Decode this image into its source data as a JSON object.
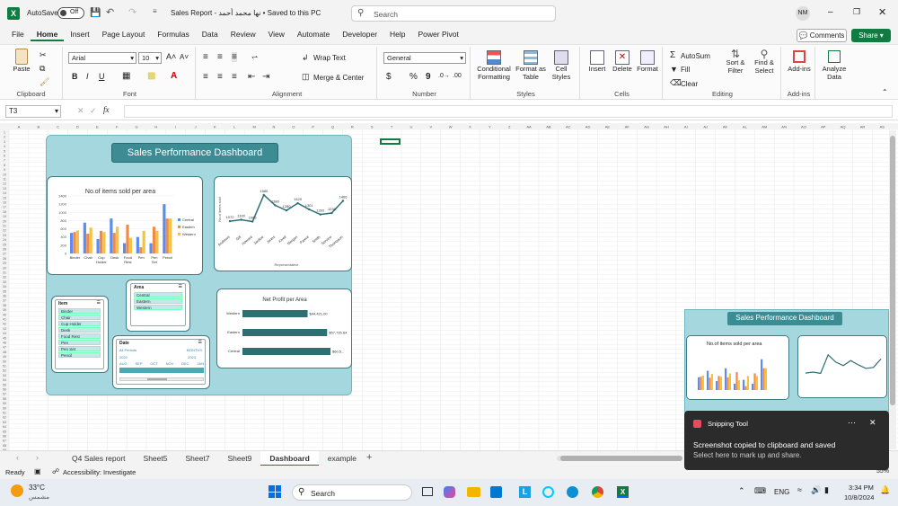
{
  "title_bar": {
    "autosave_label": "AutoSave",
    "autosave_state": "Off",
    "file_title": "Sales Report - نها محمد أحمد • Saved to this PC",
    "search_placeholder": "Search",
    "user_initials": "NM"
  },
  "menu": {
    "items": [
      "File",
      "Home",
      "Insert",
      "Page Layout",
      "Formulas",
      "Data",
      "Review",
      "View",
      "Automate",
      "Developer",
      "Help",
      "Power Pivot"
    ],
    "comments_label": "Comments",
    "share_label": "Share"
  },
  "ribbon": {
    "clipboard": {
      "paste": "Paste",
      "label": "Clipboard"
    },
    "font": {
      "name": "Arial",
      "size": "10",
      "label": "Font"
    },
    "alignment": {
      "wrap": "Wrap Text",
      "merge": "Merge & Center",
      "label": "Alignment"
    },
    "number": {
      "format": "General",
      "label": "Number"
    },
    "styles": {
      "cond": "Conditional Formatting",
      "table": "Format as Table",
      "cell": "Cell Styles",
      "label": "Styles"
    },
    "cells": {
      "insert": "Insert",
      "delete": "Delete",
      "format": "Format",
      "label": "Cells"
    },
    "editing": {
      "autosum": "AutoSum",
      "fill": "Fill",
      "clear": "Clear",
      "sort": "Sort & Filter",
      "find": "Find & Select",
      "label": "Editing"
    },
    "addins": {
      "addins": "Add-ins",
      "label": "Add-ins"
    },
    "analyze": {
      "label": "Analyze Data"
    }
  },
  "formula_bar": {
    "name_box": "T3",
    "fx": "fx",
    "value": ""
  },
  "grid": {
    "columns": [
      "A",
      "B",
      "C",
      "D",
      "E",
      "F",
      "G",
      "H",
      "I",
      "J",
      "K",
      "L",
      "M",
      "N",
      "O",
      "P",
      "Q",
      "R",
      "S",
      "T",
      "U",
      "V",
      "W",
      "X",
      "Y",
      "Z",
      "AA",
      "AB",
      "AC",
      "AD",
      "AE",
      "AF",
      "AG",
      "AH",
      "AI",
      "AJ",
      "AK",
      "AL",
      "AM",
      "AN",
      "AO",
      "AP",
      "AQ",
      "AR",
      "AS"
    ],
    "rows_count": 70
  },
  "dashboard": {
    "title": "Sales Performance Dashboard",
    "items_chart": {
      "title": "No.of items sold per area",
      "yticks": [
        "1400",
        "1200",
        "1000",
        "800",
        "600",
        "400",
        "200",
        "0"
      ],
      "legend": [
        "Central",
        "Eastern",
        "Western"
      ]
    },
    "rep_chart": {
      "ylabel": "No.of items sold",
      "xlabel": "Representative"
    },
    "profit_chart": {
      "title": "Net Profit per Area"
    },
    "slicer_area": {
      "title": "Area",
      "items": [
        "Central",
        "Eastern",
        "Western"
      ]
    },
    "slicer_item": {
      "title": "Item",
      "items": [
        "Binder",
        "Chair",
        "Cup Holder",
        "Desk",
        "Food Rest",
        "Pen",
        "Pen Set",
        "Pencil"
      ]
    },
    "slicer_date": {
      "title": "Date",
      "left": "All Periods",
      "right": "MONTHS",
      "year_left": "2022",
      "year_right": "2023",
      "months": [
        "AUG",
        "SEP",
        "OCT",
        "NOV",
        "DEC",
        "JAN"
      ]
    }
  },
  "chart_data": [
    {
      "type": "bar",
      "title": "No.of items sold per area",
      "categories": [
        "Binder",
        "Chair",
        "Cup Holder",
        "Desk",
        "Food Rest",
        "Pen",
        "Pen Set",
        "Pencil"
      ],
      "series": [
        {
          "name": "Central",
          "values": [
            500,
            750,
            350,
            850,
            250,
            400,
            250,
            1200
          ]
        },
        {
          "name": "Eastern",
          "values": [
            520,
            480,
            550,
            500,
            700,
            150,
            650,
            850
          ]
        },
        {
          "name": "Western",
          "values": [
            560,
            630,
            520,
            650,
            380,
            550,
            550,
            850
          ]
        }
      ],
      "ylim": [
        0,
        1400
      ],
      "colors": [
        "#5b8def",
        "#f08a4b",
        "#f5c242"
      ]
    },
    {
      "type": "line",
      "categories": [
        "Andrews",
        "Gill",
        "Howard",
        "Jardine",
        "Jones",
        "Kivell",
        "Morgan",
        "Parent",
        "Smith",
        "Sorvino",
        "Thompson"
      ],
      "values": [
        1072,
        1100,
        1065,
        1580,
        1380,
        1280,
        1420,
        1301,
        1202,
        1230,
        1466
      ],
      "labels": [
        "1072",
        "1100",
        "1065",
        "1580",
        "1380",
        "1280",
        "1420",
        "1301",
        "1202",
        "1230",
        "1466"
      ],
      "ylabel": "No.of items sold",
      "xlabel": "Representative",
      "color": "#2e6f73"
    },
    {
      "type": "bar",
      "orientation": "horizontal",
      "title": "Net Profit per Area",
      "categories": [
        "Western",
        "Eastern",
        "Central"
      ],
      "values": [
        44421.0,
        57735.64,
        60000
      ],
      "labels": [
        "$44,421.00",
        "$57,735.64",
        "$60,5..."
      ],
      "color": "#2e6f73"
    }
  ],
  "sheet_tabs": [
    "Q4 Sales report",
    "Sheet5",
    "Sheet7",
    "Sheet9",
    "Dashboard",
    "example"
  ],
  "active_tab": "Dashboard",
  "status": {
    "ready": "Ready",
    "accessibility": "Accessibility: Investigate",
    "zoom": "55%"
  },
  "popup": {
    "title": "Sales Performance Dashboard",
    "chart_title": "No.of items sold per area"
  },
  "toast": {
    "app": "Snipping Tool",
    "message": "Screenshot copied to clipboard and saved",
    "sub": "Select here to mark up and share."
  },
  "taskbar": {
    "temp": "33°C",
    "weather": "مشمس",
    "search": "Search",
    "lang": "ENG",
    "time": "3:34 PM",
    "date": "10/8/2024"
  }
}
